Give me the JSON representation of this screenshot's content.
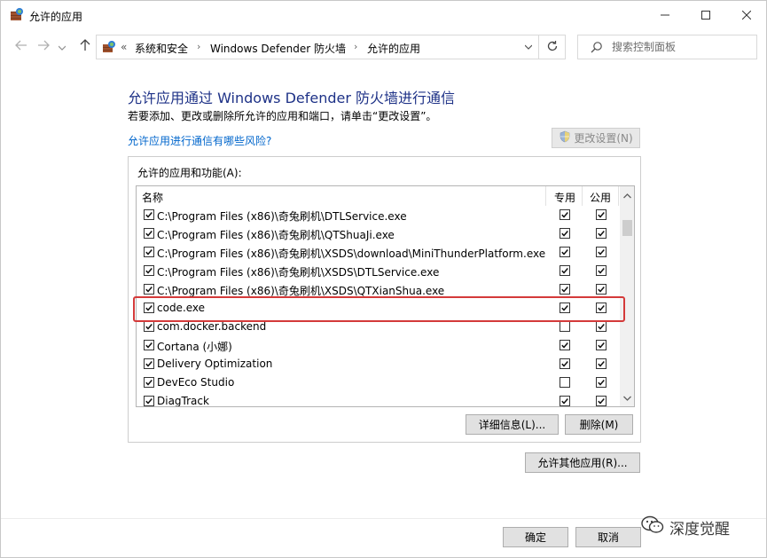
{
  "window": {
    "title": "允许的应用",
    "icon": "firewall-icon"
  },
  "nav": {
    "back_icon": "arrow-left-icon",
    "forward_icon": "arrow-right-icon",
    "recent_icon": "chevron-down-icon",
    "up_icon": "arrow-up-icon"
  },
  "address": {
    "overflow": "«",
    "crumbs": [
      "系统和安全",
      "Windows Defender 防火墙",
      "允许的应用"
    ]
  },
  "search": {
    "placeholder": "搜索控制面板"
  },
  "page": {
    "heading": "允许应用通过 Windows Defender 防火墙进行通信",
    "subtext": "若要添加、更改或删除所允许的应用和端口，请单击“更改设置”。",
    "risk_link": "允许应用进行通信有哪些风险?",
    "change_settings": "更改设置(N)"
  },
  "apps": {
    "group_label": "允许的应用和功能(A):",
    "columns": {
      "name": "名称",
      "private": "专用",
      "public": "公用"
    },
    "rows": [
      {
        "name": "C:\\Program Files (x86)\\奇兔刷机\\DTLService.exe",
        "enabled": true,
        "private": true,
        "public": true
      },
      {
        "name": "C:\\Program Files (x86)\\奇兔刷机\\QTShuaJi.exe",
        "enabled": true,
        "private": true,
        "public": true
      },
      {
        "name": "C:\\Program Files (x86)\\奇兔刷机\\XSDS\\download\\MiniThunderPlatform.exe",
        "enabled": true,
        "private": true,
        "public": true
      },
      {
        "name": "C:\\Program Files (x86)\\奇兔刷机\\XSDS\\DTLService.exe",
        "enabled": true,
        "private": true,
        "public": true
      },
      {
        "name": "C:\\Program Files (x86)\\奇兔刷机\\XSDS\\QTXianShua.exe",
        "enabled": true,
        "private": true,
        "public": true
      },
      {
        "name": "code.exe",
        "enabled": true,
        "private": true,
        "public": true
      },
      {
        "name": "com.docker.backend",
        "enabled": true,
        "private": false,
        "public": true
      },
      {
        "name": "Cortana (小娜)",
        "enabled": true,
        "private": true,
        "public": true
      },
      {
        "name": "Delivery Optimization",
        "enabled": true,
        "private": true,
        "public": true
      },
      {
        "name": "DevEco Studio",
        "enabled": true,
        "private": false,
        "public": true
      },
      {
        "name": "DiagTrack",
        "enabled": true,
        "private": true,
        "public": true
      }
    ]
  },
  "buttons": {
    "details": "详细信息(L)...",
    "remove": "删除(M)",
    "allow_other": "允许其他应用(R)...",
    "ok": "确定",
    "cancel": "取消"
  },
  "watermark": {
    "text": "深度觉醒",
    "icon": "wechat-icon"
  },
  "colors": {
    "heading": "#1e3287",
    "link": "#0066cc",
    "highlight": "#d43a3a"
  }
}
